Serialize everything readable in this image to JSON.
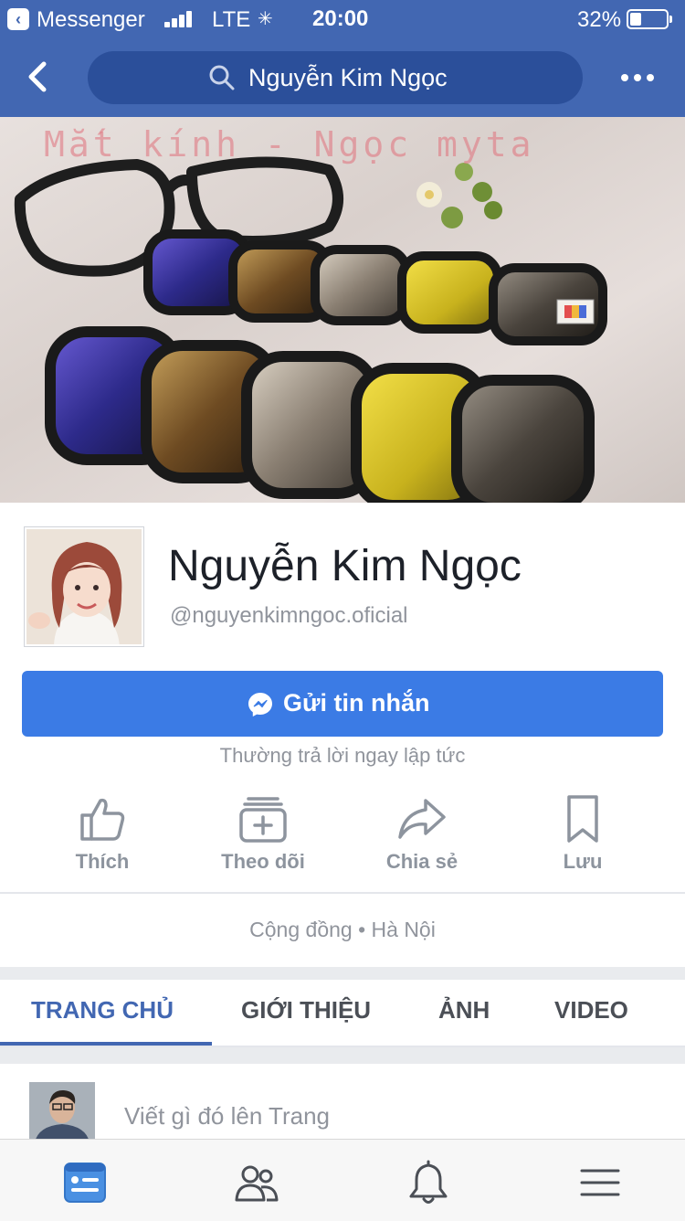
{
  "status_bar": {
    "app_name": "Messenger",
    "network": "LTE",
    "time": "20:00",
    "battery_percent": "32%",
    "battery_level": 0.32
  },
  "nav": {
    "search_value": "Nguyễn Kim Ngọc"
  },
  "cover": {
    "watermark": "Mắt kính - Ngọc myta"
  },
  "profile": {
    "name": "Nguyễn Kim Ngọc",
    "handle": "@nguyenkimngoc.oficial"
  },
  "message_button": {
    "label": "Gửi tin nhắn"
  },
  "reply_note": "Thường trả lời ngay lập tức",
  "actions": [
    {
      "label": "Thích",
      "icon": "thumbs-up-icon"
    },
    {
      "label": "Theo dõi",
      "icon": "follow-icon"
    },
    {
      "label": "Chia sẻ",
      "icon": "share-icon"
    },
    {
      "label": "Lưu",
      "icon": "bookmark-icon"
    }
  ],
  "category": "Cộng đồng • Hà Nội",
  "tabs": [
    {
      "label": "TRANG CHỦ",
      "active": true
    },
    {
      "label": "GIỚI THIỆU",
      "active": false
    },
    {
      "label": "ẢNH",
      "active": false
    },
    {
      "label": "VIDEO",
      "active": false
    }
  ],
  "composer": {
    "placeholder": "Viết gì đó lên Trang"
  },
  "bottom_tabs": [
    {
      "icon": "news-feed-icon",
      "active": true
    },
    {
      "icon": "friends-icon",
      "active": false
    },
    {
      "icon": "notifications-icon",
      "active": false
    },
    {
      "icon": "menu-icon",
      "active": false
    }
  ],
  "colors": {
    "brand_blue": "#4267b2",
    "button_blue": "#3b7be5",
    "muted_text": "#90949c"
  }
}
